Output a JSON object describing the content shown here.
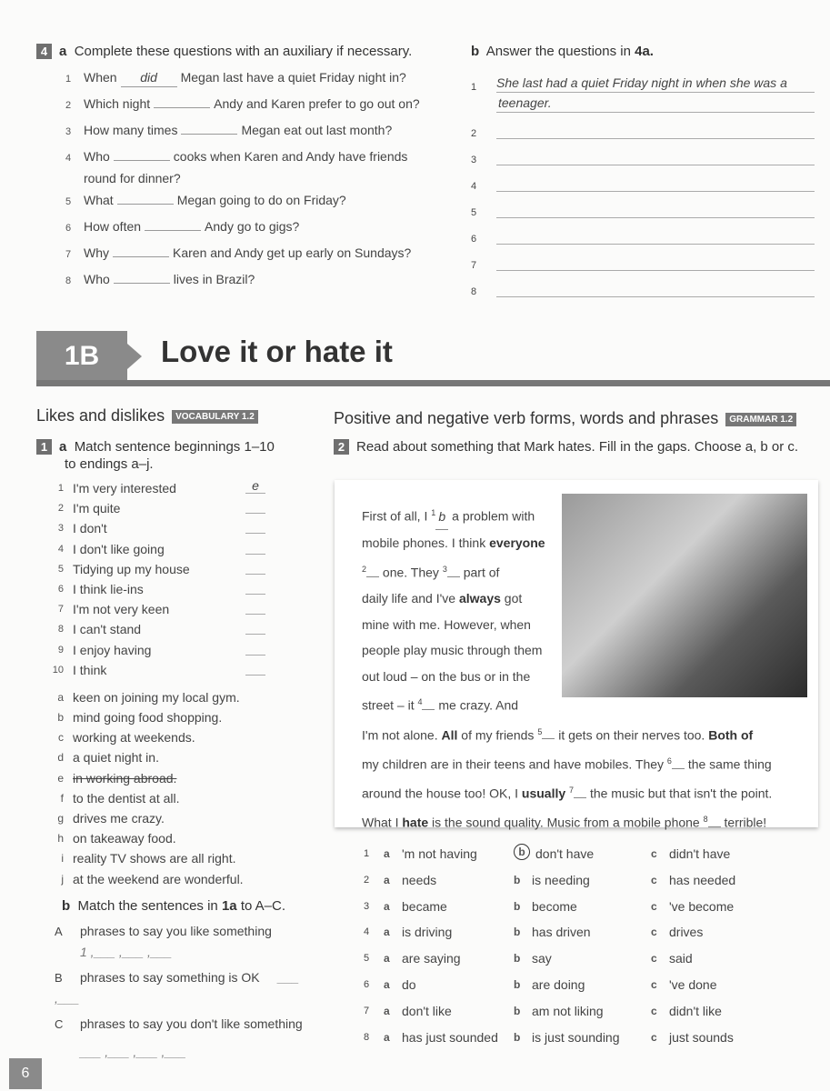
{
  "ex4": {
    "number": "4",
    "a": {
      "letter": "a",
      "instruction": "Complete these questions with an auxiliary if necessary.",
      "items": [
        {
          "n": "1",
          "pre": "When",
          "answer": "did",
          "post": "Megan last have a quiet Friday night in?"
        },
        {
          "n": "2",
          "pre": "Which night",
          "answer": "",
          "post": "Andy and Karen prefer to go out on?"
        },
        {
          "n": "3",
          "pre": "How many times",
          "answer": "",
          "post": "Megan eat out last month?"
        },
        {
          "n": "4",
          "pre": "Who",
          "answer": "",
          "post": "cooks when Karen and Andy have friends",
          "cont": "round for dinner?"
        },
        {
          "n": "5",
          "pre": "What",
          "answer": "",
          "post": "Megan going to do on Friday?"
        },
        {
          "n": "6",
          "pre": "How often",
          "answer": "",
          "post": "Andy go to gigs?"
        },
        {
          "n": "7",
          "pre": "Why",
          "answer": "",
          "post": "Karen and Andy get up early on Sundays?"
        },
        {
          "n": "8",
          "pre": "Who",
          "answer": "",
          "post": "lives in Brazil?"
        }
      ]
    },
    "b": {
      "letter": "b",
      "instruction": "Answer the questions in",
      "ref": "4a.",
      "answers": [
        {
          "n": "1",
          "text": "She last had a quiet Friday night in when she was a",
          "cont": "teenager."
        },
        {
          "n": "2",
          "text": ""
        },
        {
          "n": "3",
          "text": ""
        },
        {
          "n": "4",
          "text": ""
        },
        {
          "n": "5",
          "text": ""
        },
        {
          "n": "6",
          "text": ""
        },
        {
          "n": "7",
          "text": ""
        },
        {
          "n": "8",
          "text": ""
        }
      ]
    }
  },
  "unit": {
    "code": "1B",
    "title": "Love it or hate it"
  },
  "vocab": {
    "title": "Likes and dislikes",
    "tag": "VOCABULARY 1.2",
    "ex_number": "1",
    "a": {
      "letter": "a",
      "instruction": "Match sentence beginnings 1–10",
      "instruction2": "to endings a–j.",
      "beginnings": [
        {
          "n": "1",
          "text": "I'm very interested",
          "answer": "e"
        },
        {
          "n": "2",
          "text": "I'm quite",
          "answer": ""
        },
        {
          "n": "3",
          "text": "I don't",
          "answer": ""
        },
        {
          "n": "4",
          "text": "I don't like going",
          "answer": ""
        },
        {
          "n": "5",
          "text": "Tidying up my house",
          "answer": ""
        },
        {
          "n": "6",
          "text": "I think lie-ins",
          "answer": ""
        },
        {
          "n": "7",
          "text": "I'm not very keen",
          "answer": ""
        },
        {
          "n": "8",
          "text": "I can't stand",
          "answer": ""
        },
        {
          "n": "9",
          "text": "I enjoy having",
          "answer": ""
        },
        {
          "n": "10",
          "text": "I think",
          "answer": ""
        }
      ],
      "endings": [
        {
          "l": "a",
          "text": "keen on joining my local gym."
        },
        {
          "l": "b",
          "text": "mind going food shopping."
        },
        {
          "l": "c",
          "text": "working at weekends."
        },
        {
          "l": "d",
          "text": "a quiet night in."
        },
        {
          "l": "e",
          "text": "in working abroad.",
          "struck": true
        },
        {
          "l": "f",
          "text": "to the dentist at all."
        },
        {
          "l": "g",
          "text": "drives me crazy."
        },
        {
          "l": "h",
          "text": "on takeaway food."
        },
        {
          "l": "i",
          "text": "reality TV shows are all right."
        },
        {
          "l": "j",
          "text": "at the weekend are wonderful."
        }
      ]
    },
    "b": {
      "letter": "b",
      "instruction_pre": "Match the sentences in",
      "ref": "1a",
      "instruction_post": "to A–C.",
      "groups": [
        {
          "l": "A",
          "text": "phrases to say you like something",
          "answers": "1 ,___ ,___ ,___"
        },
        {
          "l": "B",
          "text": "phrases to say something is OK",
          "answers": "___ ,___"
        },
        {
          "l": "C",
          "text": "phrases to say you don't like something",
          "answers": "___ ,___ ,___ ,___"
        }
      ]
    }
  },
  "grammar": {
    "title": "Positive and negative verb forms, words and phrases",
    "tag": "GRAMMAR 1.2",
    "ex_number": "2",
    "instruction": "Read about something that Mark hates. Fill in the gaps. Choose a, b or c.",
    "text_gap1_answer": "b",
    "options": [
      {
        "n": "1",
        "a": "'m not having",
        "b": "don't have",
        "c": "didn't have",
        "circled": "b"
      },
      {
        "n": "2",
        "a": "needs",
        "b": "is needing",
        "c": "has needed"
      },
      {
        "n": "3",
        "a": "became",
        "b": "become",
        "c": "'ve become"
      },
      {
        "n": "4",
        "a": "is driving",
        "b": "has driven",
        "c": "drives"
      },
      {
        "n": "5",
        "a": "are saying",
        "b": "say",
        "c": "said"
      },
      {
        "n": "6",
        "a": "do",
        "b": "are doing",
        "c": "'ve done"
      },
      {
        "n": "7",
        "a": "don't like",
        "b": "am not liking",
        "c": "didn't like"
      },
      {
        "n": "8",
        "a": "has just sounded",
        "b": "is just sounding",
        "c": "just sounds"
      }
    ]
  },
  "page_number": "6"
}
